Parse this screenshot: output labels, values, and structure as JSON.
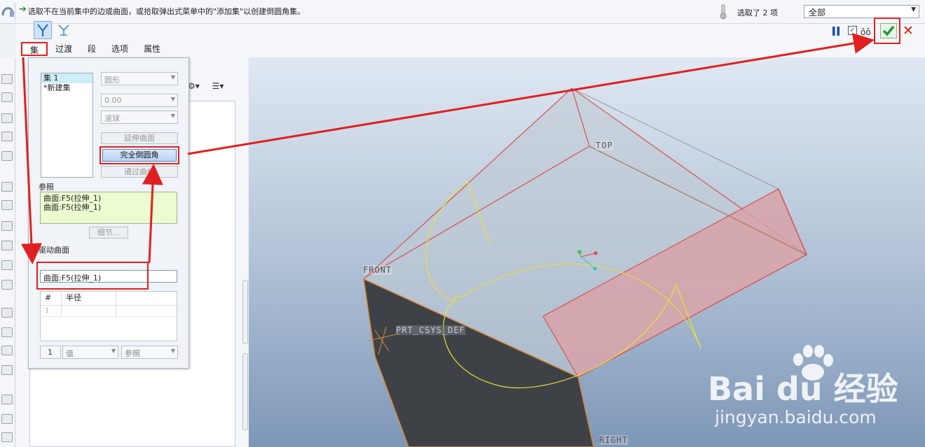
{
  "message": {
    "text": "选取不在当前集中的边或曲面，或拾取弹出式菜单中的\"添加集\"以创建倒圆角集。",
    "arrow_icon": "green-arrow-icon"
  },
  "selection": {
    "count_text": "选取了 2 项",
    "filter_value": "全部"
  },
  "tabs": [
    "集",
    "过渡",
    "段",
    "选项",
    "属性"
  ],
  "sets_panel": {
    "set_items": [
      "集 1",
      "*新建集"
    ],
    "shape_dropdown": "圆形",
    "value_dropdown": "0.00",
    "method_dropdown": "滚球",
    "extend_button": "延伸曲面",
    "full_round_button": "完全倒圆角",
    "through_curve_button": "通过曲线",
    "refs_label": "参照",
    "refs": [
      "曲面:F5(拉伸_1)",
      "曲面:F5(拉伸_1)"
    ],
    "details_button": "细节...",
    "driving_label": "驱动曲面",
    "driving_value": "曲面:F5(拉伸_1)",
    "radius_table": {
      "col_num": "#",
      "col_radius": "半径",
      "row_num": "1"
    },
    "index_value": "1",
    "value_mode": "值",
    "ref_mode": "参照"
  },
  "viewport": {
    "label_top": "TOP",
    "label_front": "FRONT",
    "label_csys": "PRT_CSYS_DEF",
    "label_right": "RIGHT"
  },
  "watermark": {
    "logo": "Bai du 经验",
    "url": "jingyan.baidu.com"
  },
  "colors": {
    "highlight": "#e02020",
    "accept": "#1f9a2a",
    "cancel": "#d21a1a",
    "ref_bg": "#ecfbd0"
  }
}
